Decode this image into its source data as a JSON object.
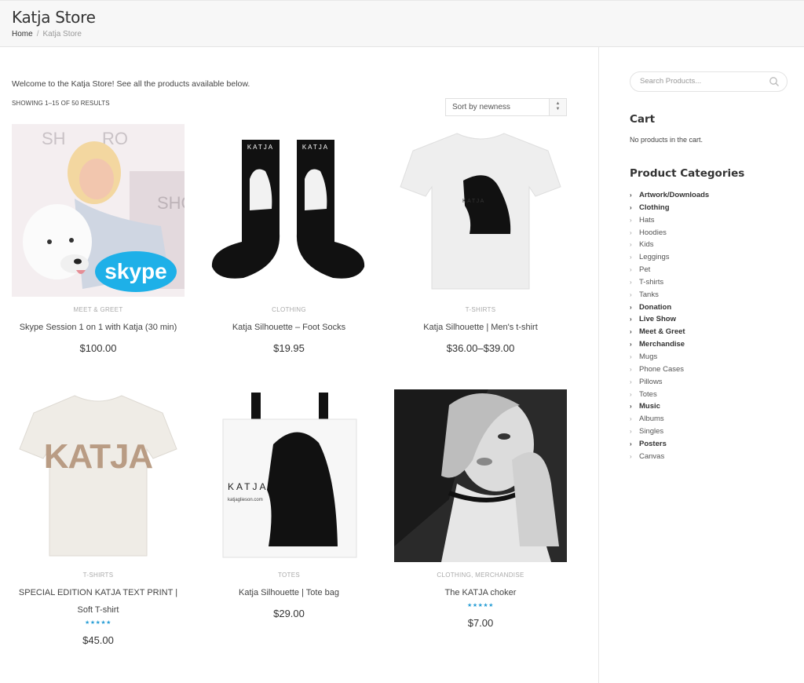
{
  "header": {
    "title": "Katja Store",
    "breadcrumb": {
      "home": "Home",
      "separator": "/",
      "current": "Katja Store"
    }
  },
  "shop": {
    "welcome": "Welcome to the Katja Store! See all the products available below.",
    "result_count": "SHOWING 1–15 OF 50 RESULTS",
    "sort": {
      "selected": "Sort by newness"
    }
  },
  "products": [
    {
      "category": "MEET & GREET",
      "name": "Skype Session 1 on 1 with Katja (30 min)",
      "price": "$100.00",
      "image_text": "skype"
    },
    {
      "category": "CLOTHING",
      "name": "Katja Silhouette – Foot Socks",
      "price": "$19.95",
      "image_text": "KATJA"
    },
    {
      "category": "T-SHIRTS",
      "name": "Katja Silhouette | Men's t-shirt",
      "price": "$36.00–$39.00",
      "image_text": "KATJA"
    },
    {
      "category": "T-SHIRTS",
      "name": "SPECIAL EDITION KATJA TEXT PRINT | Soft T-shirt",
      "price": "$45.00",
      "stars": "★★★★★",
      "image_text": "KATJA"
    },
    {
      "category": "TOTES",
      "name": "Katja Silhouette | Tote bag",
      "price": "$29.00",
      "image_text": "KATJA",
      "image_subtext": "katjaglieson.com"
    },
    {
      "category": "CLOTHING, MERCHANDISE",
      "name": "The KATJA choker",
      "price": "$7.00",
      "stars": "★★★★★"
    }
  ],
  "sidebar": {
    "search_placeholder": "Search Products...",
    "cart_title": "Cart",
    "cart_empty": "No products in the cart.",
    "categories_title": "Product Categories",
    "categories": [
      {
        "label": "Artwork/Downloads",
        "parent": true
      },
      {
        "label": "Clothing",
        "parent": true
      },
      {
        "label": "Hats",
        "parent": false
      },
      {
        "label": "Hoodies",
        "parent": false
      },
      {
        "label": "Kids",
        "parent": false
      },
      {
        "label": "Leggings",
        "parent": false
      },
      {
        "label": "Pet",
        "parent": false
      },
      {
        "label": "T-shirts",
        "parent": false
      },
      {
        "label": "Tanks",
        "parent": false
      },
      {
        "label": "Donation",
        "parent": true
      },
      {
        "label": "Live Show",
        "parent": true
      },
      {
        "label": "Meet & Greet",
        "parent": true
      },
      {
        "label": "Merchandise",
        "parent": true
      },
      {
        "label": "Mugs",
        "parent": false
      },
      {
        "label": "Phone Cases",
        "parent": false
      },
      {
        "label": "Pillows",
        "parent": false
      },
      {
        "label": "Totes",
        "parent": false
      },
      {
        "label": "Music",
        "parent": true
      },
      {
        "label": "Albums",
        "parent": false
      },
      {
        "label": "Singles",
        "parent": false
      },
      {
        "label": "Posters",
        "parent": true
      },
      {
        "label": "Canvas",
        "parent": false
      }
    ]
  },
  "colors": {
    "accent": "#2a9fd6",
    "header_bg": "#f7f7f7",
    "text": "#444444"
  }
}
